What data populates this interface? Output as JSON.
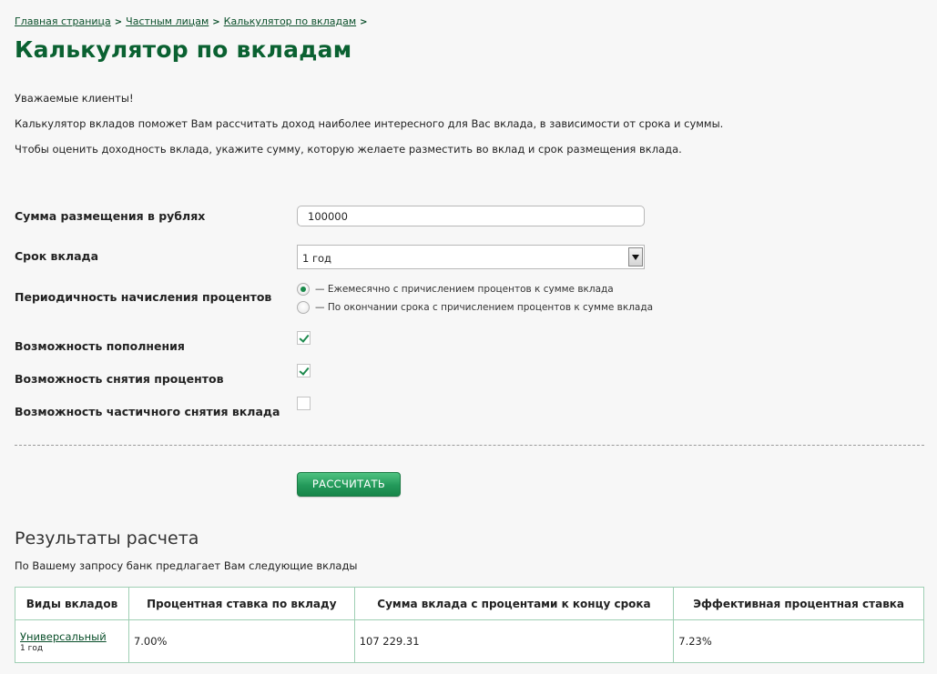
{
  "breadcrumb": {
    "items": [
      "Главная страница",
      "Частным лицам",
      "Калькулятор по вкладам"
    ],
    "separator": ">"
  },
  "page": {
    "title": "Калькулятор по вкладам",
    "intro": [
      "Уважаемые клиенты!",
      "Калькулятор вкладов поможет Вам рассчитать доход наиболее интересного для Вас вклада, в зависимости от срока и суммы.",
      "Чтобы оценить доходность вклада, укажите сумму, которую желаете разместить во вклад и срок размещения вклада."
    ]
  },
  "form": {
    "amount": {
      "label": "Сумма размещения в рублях",
      "value": "100000"
    },
    "term": {
      "label": "Срок вклада",
      "value": "1 год"
    },
    "periodicity": {
      "label": "Периодичность начисления процентов",
      "options": [
        {
          "label": "— Ежемесячно с причислением процентов к сумме вклада",
          "checked": true
        },
        {
          "label": "— По окончании срока с причислением процентов к сумме вклада",
          "checked": false
        }
      ]
    },
    "replenishment": {
      "label": "Возможность пополнения",
      "checked": true
    },
    "interest_withdrawal": {
      "label": "Возможность снятия процентов",
      "checked": true
    },
    "partial_withdrawal": {
      "label": "Возможность частичного снятия вклада",
      "checked": false
    },
    "calculate_label": "РАССЧИТАТЬ"
  },
  "results": {
    "title": "Результаты расчета",
    "note": "По Вашему запросу банк предлагает Вам следующие вклады",
    "columns": [
      "Виды вкладов",
      "Процентная ставка по вкладу",
      "Сумма вклада с процентами к концу срока",
      "Эффективная процентная ставка"
    ],
    "rows": [
      {
        "name": "Универсальный",
        "term": "1 год",
        "rate": "7.00%",
        "total": "107 229.31",
        "effective_rate": "7.23%"
      }
    ]
  },
  "colors": {
    "title_green": "#0a6131",
    "link_green": "#0a4f2a",
    "button_green": "#23995a",
    "table_border": "#9fcfb4"
  }
}
